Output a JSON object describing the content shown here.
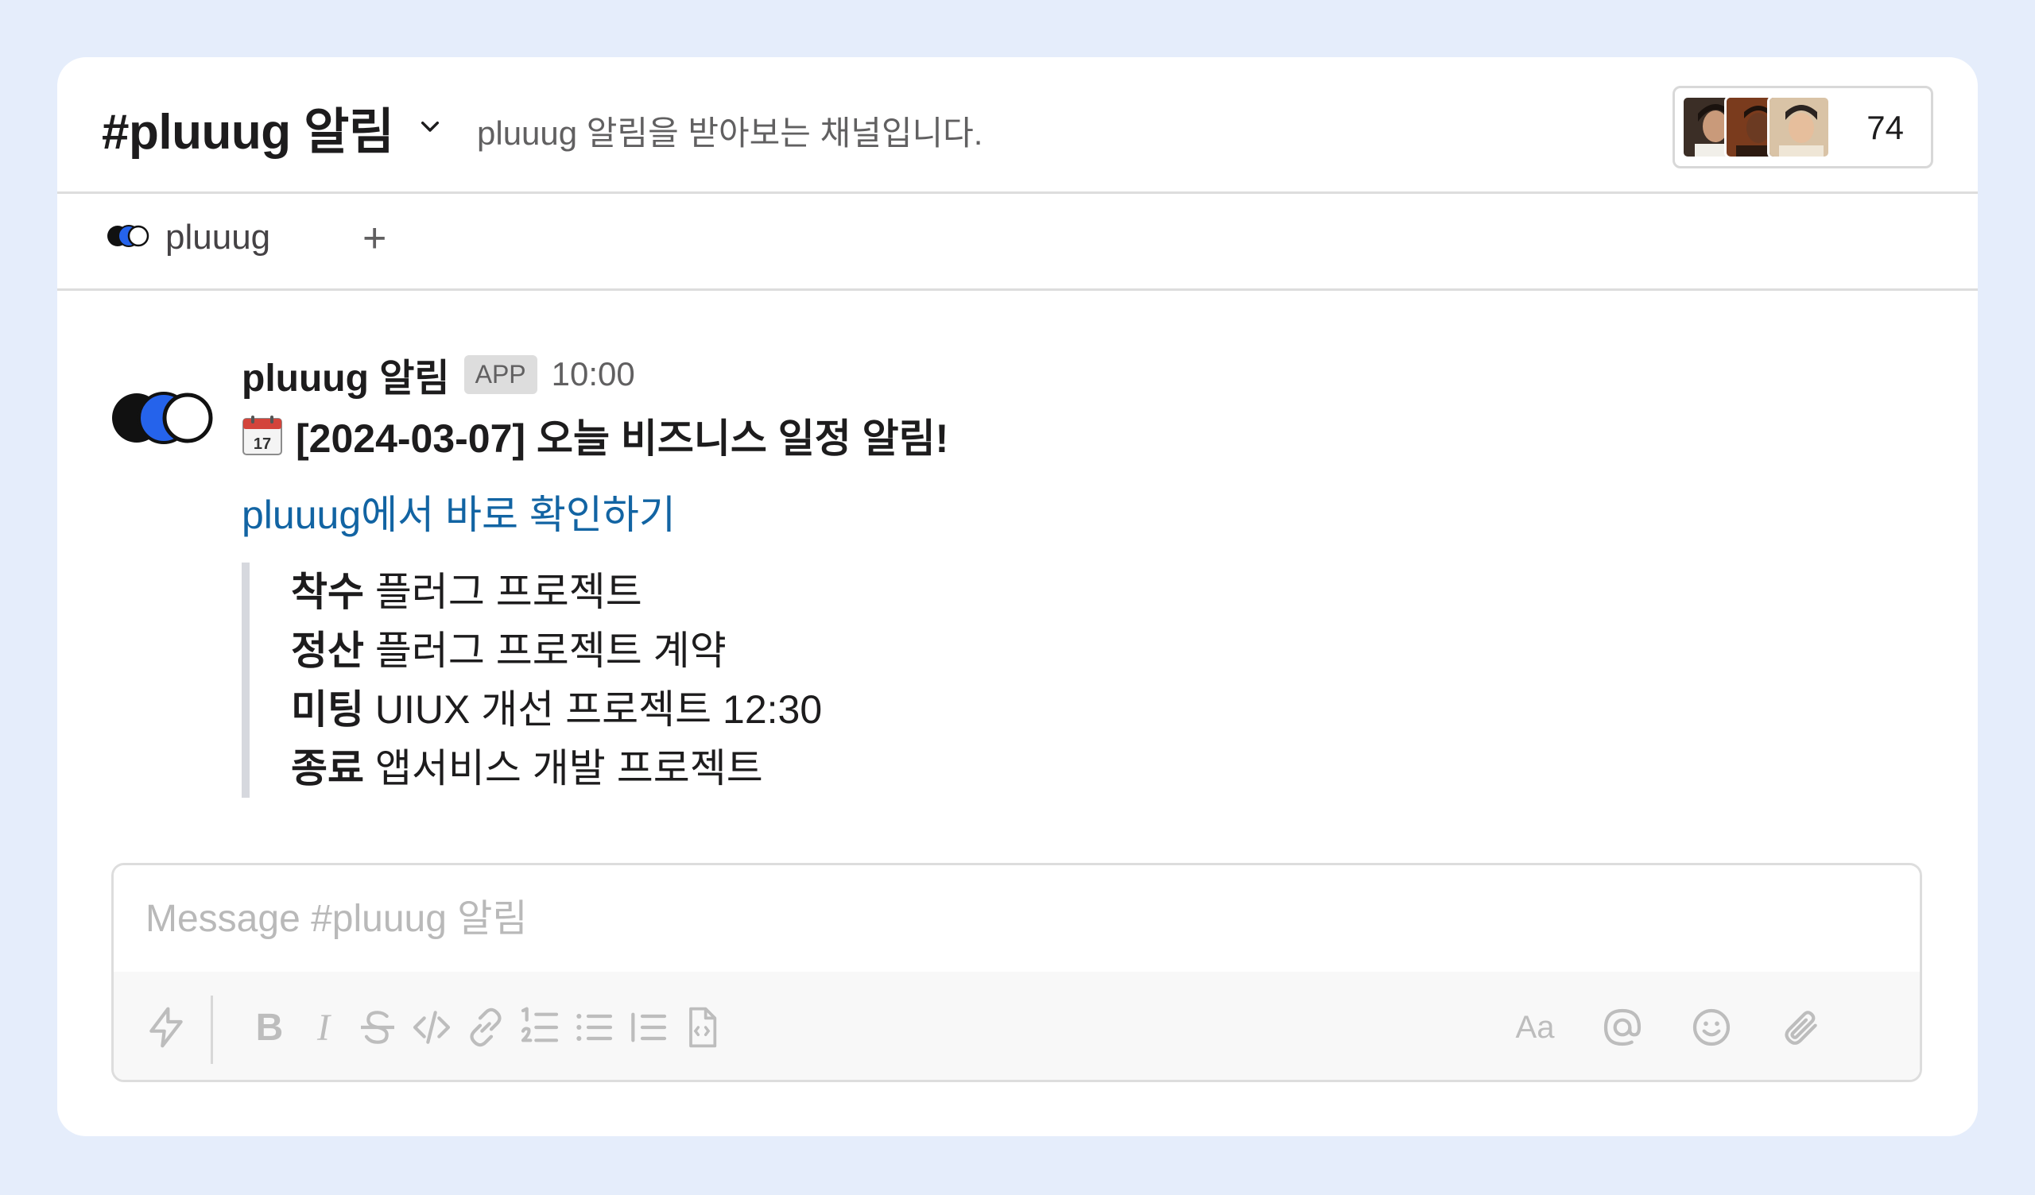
{
  "header": {
    "channel_name": "#pluuug 알림",
    "topic": "pluuug 알림을 받아보는 채널입니다.",
    "member_count": "74"
  },
  "tabs": {
    "bookmark_label": "pluuug",
    "add_label": "+"
  },
  "message": {
    "sender": "pluuug 알림",
    "badge": "APP",
    "time": "10:00",
    "calendar_day": "17",
    "title": "[2024-03-07] 오늘 비즈니스 일정 알림!",
    "link": "pluuug에서 바로 확인하기",
    "items": [
      {
        "label": "착수",
        "text": "플러그 프로젝트"
      },
      {
        "label": "정산",
        "text": "플러그 프로젝트 계약"
      },
      {
        "label": "미팅",
        "text": "UIUX 개선 프로젝트 12:30"
      },
      {
        "label": "종료",
        "text": "앱서비스 개발 프로젝트"
      }
    ]
  },
  "composer": {
    "placeholder": "Message #pluuug 알림",
    "toolbar_icons": [
      "lightning-icon",
      "bold-icon",
      "italic-icon",
      "strikethrough-icon",
      "code-icon",
      "link-icon",
      "ordered-list-icon",
      "bullet-list-icon",
      "blockquote-icon",
      "code-block-icon",
      "format-text-icon",
      "mention-icon",
      "emoji-icon",
      "attach-icon"
    ],
    "bold_glyph": "B",
    "italic_glyph": "I",
    "format_glyph": "Aa"
  },
  "colors": {
    "page_bg": "#e5edfb",
    "link": "#1264a3",
    "logo_blue": "#2563eb",
    "border": "#dddddd"
  }
}
